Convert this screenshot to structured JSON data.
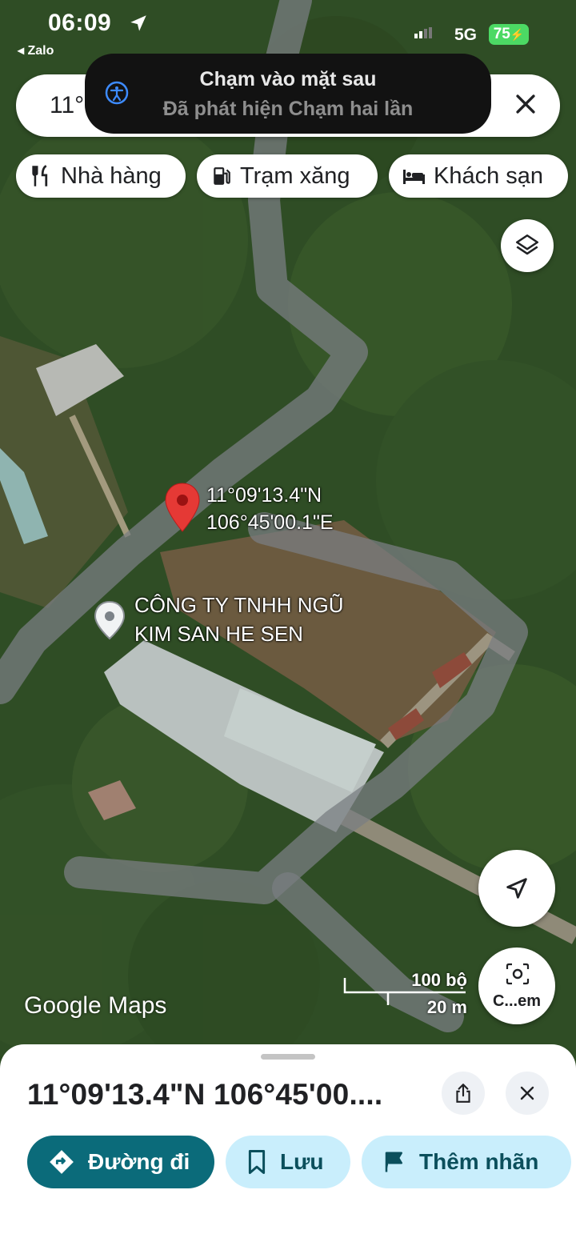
{
  "status_bar": {
    "time": "06:09",
    "back_app": "◂ Zalo",
    "network": "5G",
    "battery": "75"
  },
  "toast": {
    "title": "Chạm vào mặt sau",
    "subtitle": "Đã phát hiện Chạm hai lần"
  },
  "search": {
    "text": "11°0"
  },
  "chips": [
    {
      "label": "Nhà hàng",
      "icon": "restaurant-icon"
    },
    {
      "label": "Trạm xăng",
      "icon": "gas-station-icon"
    },
    {
      "label": "Khách sạn",
      "icon": "hotel-icon"
    }
  ],
  "map": {
    "pin_label_line1": "11°09'13.4\"N",
    "pin_label_line2": "106°45'00.1\"E",
    "place_line1": "CÔNG TY TNHH NGŨ",
    "place_line2": "KIM SAN HE SEN",
    "scale_top": "100 bộ",
    "scale_bottom": "20 m",
    "logo": "Google Maps",
    "lens_label": "C...em"
  },
  "sheet": {
    "coords": "11°09'13.4\"N 106°45'00....",
    "directions_label": "Đường đi",
    "save_label": "Lưu",
    "add_label": "Thêm nhãn"
  },
  "colors": {
    "accent": "#0b6b7a",
    "pin": "#e53935",
    "tonal": "#c9eefc"
  }
}
